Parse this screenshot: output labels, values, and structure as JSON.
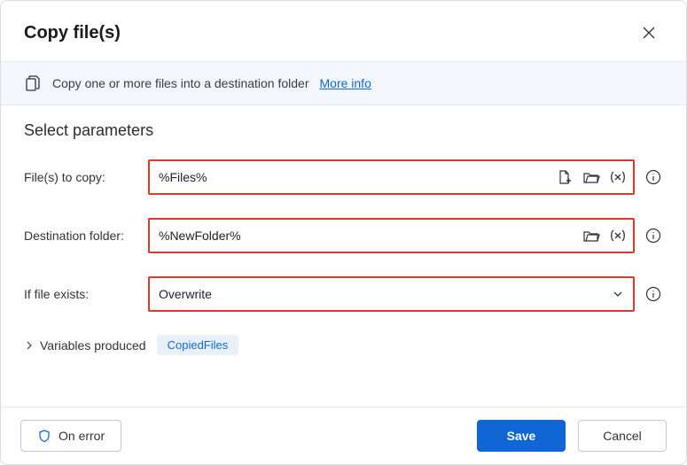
{
  "header": {
    "title": "Copy file(s)"
  },
  "banner": {
    "text": "Copy one or more files into a destination folder",
    "link_label": "More info"
  },
  "section_title": "Select parameters",
  "params": {
    "files": {
      "label": "File(s) to copy:",
      "value": "%Files%"
    },
    "destination": {
      "label": "Destination folder:",
      "value": "%NewFolder%"
    },
    "if_exists": {
      "label": "If file exists:",
      "value": "Overwrite"
    }
  },
  "variables": {
    "label": "Variables produced",
    "chip": "CopiedFiles"
  },
  "footer": {
    "on_error": "On error",
    "save": "Save",
    "cancel": "Cancel"
  }
}
